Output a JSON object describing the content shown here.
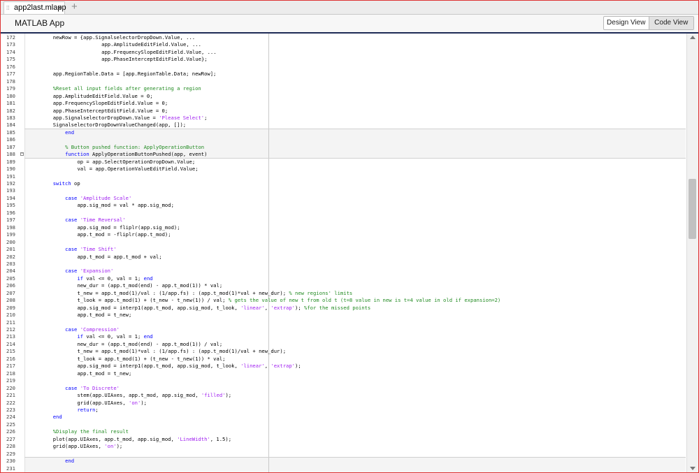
{
  "tab": {
    "label": "app2last.mlapp",
    "close": "×",
    "add": "+"
  },
  "header": {
    "title": "MATLAB App",
    "design_view": "Design View",
    "code_view": "Code View"
  },
  "editor": {
    "lines": [
      {
        "n": "172",
        "i": 8,
        "t": [
          [
            "newRow = {app.SignalselectorDropDown.Value, ...",
            ""
          ]
        ]
      },
      {
        "n": "173",
        "i": 24,
        "t": [
          [
            "app.AmplitudeEditField.Value, ...",
            ""
          ]
        ]
      },
      {
        "n": "174",
        "i": 24,
        "t": [
          [
            "app.FrequencySlopeEditField.Value, ...",
            ""
          ]
        ]
      },
      {
        "n": "175",
        "i": 24,
        "t": [
          [
            "app.PhaseInterceptEditField.Value};",
            ""
          ]
        ]
      },
      {
        "n": "176",
        "i": 0,
        "t": []
      },
      {
        "n": "177",
        "i": 8,
        "t": [
          [
            "app.RegionTable.Data = [app.RegionTable.Data; newRow];",
            ""
          ]
        ]
      },
      {
        "n": "178",
        "i": 0,
        "t": []
      },
      {
        "n": "179",
        "i": 8,
        "t": [
          [
            "%Reset all input fields after generating a region",
            "cm"
          ]
        ]
      },
      {
        "n": "180",
        "i": 8,
        "t": [
          [
            "app.AmplitudeEditField.Value = 0;",
            ""
          ]
        ]
      },
      {
        "n": "181",
        "i": 8,
        "t": [
          [
            "app.FrequencySlopeEditField.Value = 0;",
            ""
          ]
        ]
      },
      {
        "n": "182",
        "i": 8,
        "t": [
          [
            "app.PhaseInterceptEditField.Value = 0;",
            ""
          ]
        ]
      },
      {
        "n": "183",
        "i": 8,
        "t": [
          [
            "app.SignalselectorDropDown.Value = ",
            ""
          ],
          [
            "'Please Select'",
            "str"
          ],
          [
            ";",
            ""
          ]
        ]
      },
      {
        "n": "184",
        "i": 8,
        "t": [
          [
            "SignalselectorDropDownValueChanged(app, []);",
            ""
          ]
        ]
      },
      {
        "n": "185",
        "i": 12,
        "t": [
          [
            "end",
            "kw"
          ]
        ]
      },
      {
        "n": "186",
        "i": 0,
        "t": []
      },
      {
        "n": "187",
        "i": 12,
        "t": [
          [
            "% Button pushed function: ApplyOperationButton",
            "cm"
          ]
        ]
      },
      {
        "n": "188",
        "i": 12,
        "fold": true,
        "t": [
          [
            "function",
            "kw"
          ],
          [
            " ApplyOperationButtonPushed(app, event)",
            ""
          ]
        ]
      },
      {
        "n": "189",
        "i": 16,
        "t": [
          [
            "op = app.SelectOperationDropDown.Value;",
            ""
          ]
        ]
      },
      {
        "n": "190",
        "i": 16,
        "t": [
          [
            "val = app.OperationValueEditField.Value;",
            ""
          ]
        ]
      },
      {
        "n": "191",
        "i": 0,
        "t": []
      },
      {
        "n": "192",
        "i": 8,
        "t": [
          [
            "switch",
            "kw"
          ],
          [
            " op",
            ""
          ]
        ]
      },
      {
        "n": "193",
        "i": 0,
        "t": []
      },
      {
        "n": "194",
        "i": 12,
        "t": [
          [
            "case",
            "kw"
          ],
          [
            " ",
            ""
          ],
          [
            "'Amplitude Scale'",
            "str"
          ]
        ]
      },
      {
        "n": "195",
        "i": 16,
        "t": [
          [
            "app.sig_mod = val * app.sig_mod;",
            ""
          ]
        ]
      },
      {
        "n": "196",
        "i": 0,
        "t": []
      },
      {
        "n": "197",
        "i": 12,
        "t": [
          [
            "case",
            "kw"
          ],
          [
            " ",
            ""
          ],
          [
            "'Time Reversal'",
            "str"
          ]
        ]
      },
      {
        "n": "198",
        "i": 16,
        "t": [
          [
            "app.sig_mod = fliplr(app.sig_mod);",
            ""
          ]
        ]
      },
      {
        "n": "199",
        "i": 16,
        "t": [
          [
            "app.t_mod = -fliplr(app.t_mod);",
            ""
          ]
        ]
      },
      {
        "n": "200",
        "i": 0,
        "t": []
      },
      {
        "n": "201",
        "i": 12,
        "t": [
          [
            "case",
            "kw"
          ],
          [
            " ",
            ""
          ],
          [
            "'Time Shift'",
            "str"
          ]
        ]
      },
      {
        "n": "202",
        "i": 16,
        "t": [
          [
            "app.t_mod = app.t_mod + val;",
            ""
          ]
        ]
      },
      {
        "n": "203",
        "i": 0,
        "t": []
      },
      {
        "n": "204",
        "i": 12,
        "t": [
          [
            "case",
            "kw"
          ],
          [
            " ",
            ""
          ],
          [
            "'Expansion'",
            "str"
          ]
        ]
      },
      {
        "n": "205",
        "i": 16,
        "t": [
          [
            "if",
            "kw"
          ],
          [
            " val <= 0, val = 1; ",
            ""
          ],
          [
            "end",
            "kw"
          ]
        ]
      },
      {
        "n": "206",
        "i": 16,
        "t": [
          [
            "new_dur = (app.t_mod(end) - app.t_mod(1)) * val;",
            ""
          ]
        ]
      },
      {
        "n": "207",
        "i": 16,
        "t": [
          [
            "t_new = app.t_mod(1)/val : (1/app.fs) : (app.t_mod(1)*val + new_dur); ",
            ""
          ],
          [
            "% new regions' limits",
            "cm"
          ]
        ]
      },
      {
        "n": "208",
        "i": 16,
        "t": [
          [
            "t_look = app.t_mod(1) + (t_new - t_new(1)) / val; ",
            ""
          ],
          [
            "% gets the value of new t from old t (t=8 value in new is t=4 value in old if expansion=2)",
            "cm"
          ]
        ]
      },
      {
        "n": "209",
        "i": 16,
        "t": [
          [
            "app.sig_mod = interp1(app.t_mod, app.sig_mod, t_look, ",
            ""
          ],
          [
            "'linear'",
            "str"
          ],
          [
            ", ",
            ""
          ],
          [
            "'extrap'",
            "str"
          ],
          [
            "); ",
            ""
          ],
          [
            "%for the missed points",
            "cm"
          ]
        ]
      },
      {
        "n": "210",
        "i": 16,
        "t": [
          [
            "app.t_mod = t_new;",
            ""
          ]
        ]
      },
      {
        "n": "211",
        "i": 0,
        "t": []
      },
      {
        "n": "212",
        "i": 12,
        "t": [
          [
            "case",
            "kw"
          ],
          [
            " ",
            ""
          ],
          [
            "'Compression'",
            "str"
          ]
        ]
      },
      {
        "n": "213",
        "i": 16,
        "t": [
          [
            "if",
            "kw"
          ],
          [
            " val <= 0, val = 1; ",
            ""
          ],
          [
            "end",
            "kw"
          ]
        ]
      },
      {
        "n": "214",
        "i": 16,
        "t": [
          [
            "new_dur = (app.t_mod(end) - app.t_mod(1)) / val;",
            ""
          ]
        ]
      },
      {
        "n": "215",
        "i": 16,
        "t": [
          [
            "t_new = app.t_mod(1)*val : (1/app.fs) : (app.t_mod(1)/val + new_dur);",
            ""
          ]
        ]
      },
      {
        "n": "216",
        "i": 16,
        "t": [
          [
            "t_look = app.t_mod(1) + (t_new - t_new(1)) * val;",
            ""
          ]
        ]
      },
      {
        "n": "217",
        "i": 16,
        "t": [
          [
            "app.sig_mod = interp1(app.t_mod, app.sig_mod, t_look, ",
            ""
          ],
          [
            "'linear'",
            "str"
          ],
          [
            ", ",
            ""
          ],
          [
            "'extrap'",
            "str"
          ],
          [
            ");",
            ""
          ]
        ]
      },
      {
        "n": "218",
        "i": 16,
        "t": [
          [
            "app.t_mod = t_new;",
            ""
          ]
        ]
      },
      {
        "n": "219",
        "i": 0,
        "t": []
      },
      {
        "n": "220",
        "i": 12,
        "t": [
          [
            "case",
            "kw"
          ],
          [
            " ",
            ""
          ],
          [
            "'To Discrete'",
            "str"
          ]
        ]
      },
      {
        "n": "221",
        "i": 16,
        "t": [
          [
            "stem(app.UIAxes, app.t_mod, app.sig_mod, ",
            ""
          ],
          [
            "'filled'",
            "str"
          ],
          [
            ");",
            ""
          ]
        ]
      },
      {
        "n": "222",
        "i": 16,
        "t": [
          [
            "grid(app.UIAxes, ",
            ""
          ],
          [
            "'on'",
            "str"
          ],
          [
            ");",
            ""
          ]
        ]
      },
      {
        "n": "223",
        "i": 16,
        "t": [
          [
            "return",
            "kw"
          ],
          [
            ";",
            ""
          ]
        ]
      },
      {
        "n": "224",
        "i": 8,
        "t": [
          [
            "end",
            "kw"
          ]
        ]
      },
      {
        "n": "225",
        "i": 0,
        "t": []
      },
      {
        "n": "226",
        "i": 8,
        "t": [
          [
            "%Display the final result",
            "cm"
          ]
        ]
      },
      {
        "n": "227",
        "i": 8,
        "t": [
          [
            "plot(app.UIAxes, app.t_mod, app.sig_mod, ",
            ""
          ],
          [
            "'LineWidth'",
            "str"
          ],
          [
            ", 1.5);",
            ""
          ]
        ]
      },
      {
        "n": "228",
        "i": 8,
        "t": [
          [
            "grid(app.UIAxes, ",
            ""
          ],
          [
            "'on'",
            "str"
          ],
          [
            ");",
            ""
          ]
        ]
      },
      {
        "n": "229",
        "i": 0,
        "t": []
      },
      {
        "n": "230",
        "i": 12,
        "t": [
          [
            "end",
            "kw"
          ]
        ]
      },
      {
        "n": "231",
        "i": 0,
        "t": []
      }
    ]
  },
  "colors": {
    "keyword": "#0000ff",
    "string": "#a020f0",
    "comment": "#228b22",
    "header_rule": "#1f2b56"
  }
}
